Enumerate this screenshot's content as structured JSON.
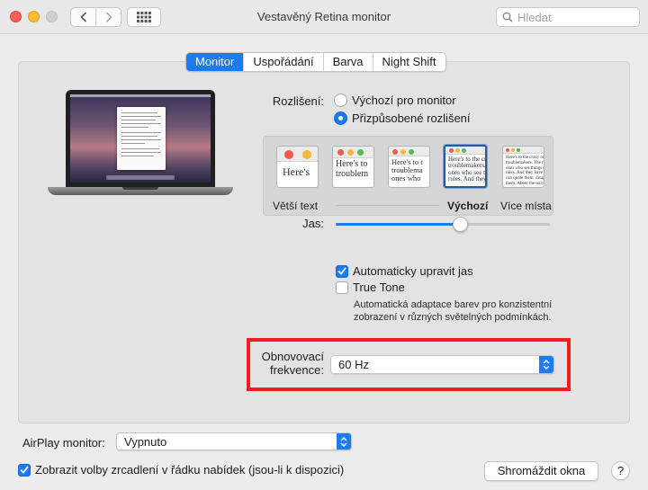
{
  "window": {
    "title": "Vestavěný Retina monitor"
  },
  "search": {
    "placeholder": "Hledat"
  },
  "tabs": [
    {
      "label": "Monitor",
      "active": true
    },
    {
      "label": "Uspořádání",
      "active": false
    },
    {
      "label": "Barva",
      "active": false
    },
    {
      "label": "Night Shift",
      "active": false
    }
  ],
  "resolution": {
    "label": "Rozlišení:",
    "options": [
      {
        "label": "Výchozí pro monitor",
        "selected": false
      },
      {
        "label": "Přizpůsobené rozlišení",
        "selected": true
      }
    ],
    "thumbs": [
      {
        "text": "Here's",
        "selected": false
      },
      {
        "text": "Here's to\ntroublem",
        "selected": false
      },
      {
        "text": "Here's to t\ntroublema\nones who",
        "selected": false
      },
      {
        "text": "Here's to the cr\ntroublemakers.\nones who see th\nrules. And they",
        "selected": true
      },
      {
        "text": "Here's to the crazy one\ntroublemakers. The rou\nones who see things dif\nrules. And they have no\ncan quote them, disagre\nthem. About the only th\nBecause they change th",
        "selected": false
      }
    ],
    "scale_left": "Větší text",
    "scale_default": "Výchozí",
    "scale_right": "Více místa"
  },
  "brightness": {
    "label": "Jas:",
    "level": 0.58
  },
  "auto_brightness": {
    "label": "Automaticky upravit jas",
    "checked": true
  },
  "true_tone": {
    "label": "True Tone",
    "checked": false,
    "description": "Automatická adaptace barev pro konzistentní zobrazení v různých světelných podmínkách."
  },
  "refresh_rate": {
    "label_line1": "Obnovovací",
    "label_line2": "frekvence:",
    "value": "60 Hz"
  },
  "airplay": {
    "label": "AirPlay monitor:",
    "value": "Vypnuto"
  },
  "mirror_option": {
    "label": "Zobrazit volby zrcadlení v řádku nabídek (jsou-li k dispozici)",
    "checked": true
  },
  "buttons": {
    "gather_windows": "Shromáždit okna",
    "help": "?"
  },
  "colors": {
    "accent": "#1b7bef",
    "highlight": "#f01d1d"
  }
}
